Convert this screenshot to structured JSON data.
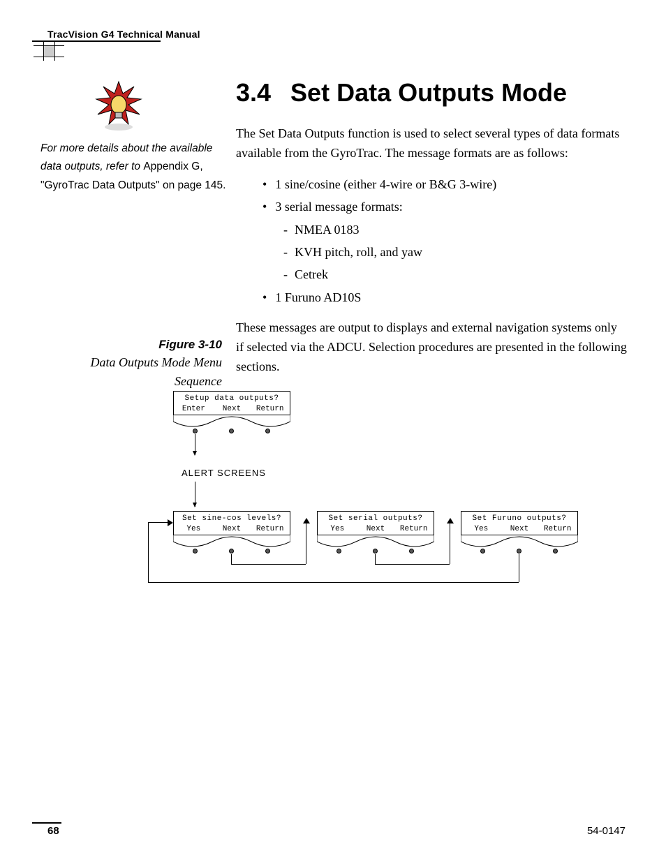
{
  "header": {
    "manual_title": "TracVision G4 Technical Manual"
  },
  "sidenote": {
    "line1_italic": "For more details about the available data outputs, refer to ",
    "line1_plain": "Appendix G, \"GyroTrac Data Outputs\" on page 145."
  },
  "section": {
    "number": "3.4",
    "title": "Set Data Outputs Mode",
    "intro": "The Set Data Outputs function is used to select several types of data formats available from the GyroTrac. The message formats are as follows:",
    "bullets": {
      "b1": "1 sine/cosine (either 4-wire or B&G 3-wire)",
      "b2": "3 serial message formats:",
      "sub1": "NMEA 0183",
      "sub2": "KVH pitch, roll, and yaw",
      "sub3": "Cetrek",
      "b3": "1 Furuno AD10S"
    },
    "outro": "These messages are output to displays and external navigation systems only if selected via the ADCU. Selection procedures are presented in the following sections."
  },
  "figure": {
    "number": "Figure 3-10",
    "caption": "Data Outputs Mode Menu Sequence",
    "alert_label": "ALERT SCREENS",
    "menus": {
      "m0": {
        "title": "Setup data outputs?",
        "a": "Enter",
        "b": "Next",
        "c": "Return"
      },
      "m1": {
        "title": "Set sine-cos levels?",
        "a": "Yes",
        "b": "Next",
        "c": "Return"
      },
      "m2": {
        "title": "Set serial outputs?",
        "a": "Yes",
        "b": "Next",
        "c": "Return"
      },
      "m3": {
        "title": "Set Furuno outputs?",
        "a": "Yes",
        "b": "Next",
        "c": "Return"
      }
    }
  },
  "footer": {
    "page": "68",
    "docnum": "54-0147"
  }
}
